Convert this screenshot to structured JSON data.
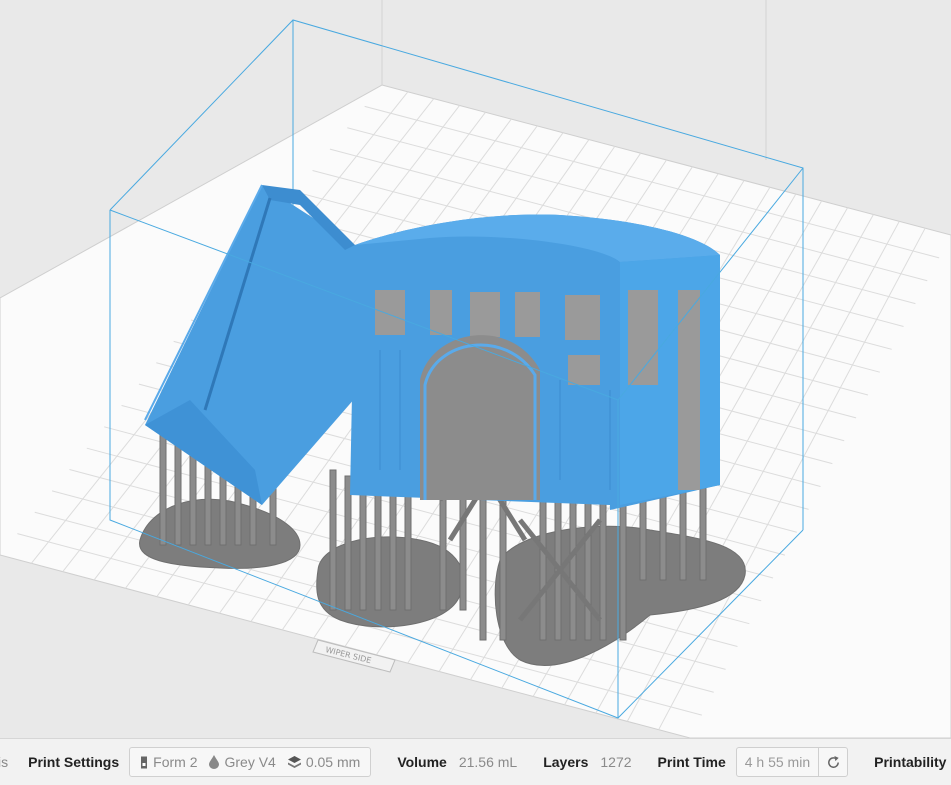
{
  "status_bar": {
    "cutoff_text": "is",
    "print_settings_label": "Print Settings",
    "printer": {
      "icon": "printer-icon",
      "value": "Form 2"
    },
    "material": {
      "icon": "resin-drop-icon",
      "value": "Grey V4"
    },
    "layer_height": {
      "icon": "layers-icon",
      "value": "0.05 mm"
    },
    "volume_label": "Volume",
    "volume_value": "21.56 mL",
    "layers_label": "Layers",
    "layers_value": "1272",
    "print_time_label": "Print Time",
    "print_time_value": "4 h 55 min",
    "refresh_icon": "refresh-icon",
    "printability_label": "Printability",
    "printability_icon": "check-icon"
  },
  "viewport": {
    "build_plate_text": "WIPER SIDE"
  },
  "colors": {
    "model": "#4a9ee0",
    "supports": "#8c8c8c",
    "build_volume": "#49a9e0",
    "background": "#e9e9e9",
    "plate": "#fbfbfb"
  }
}
